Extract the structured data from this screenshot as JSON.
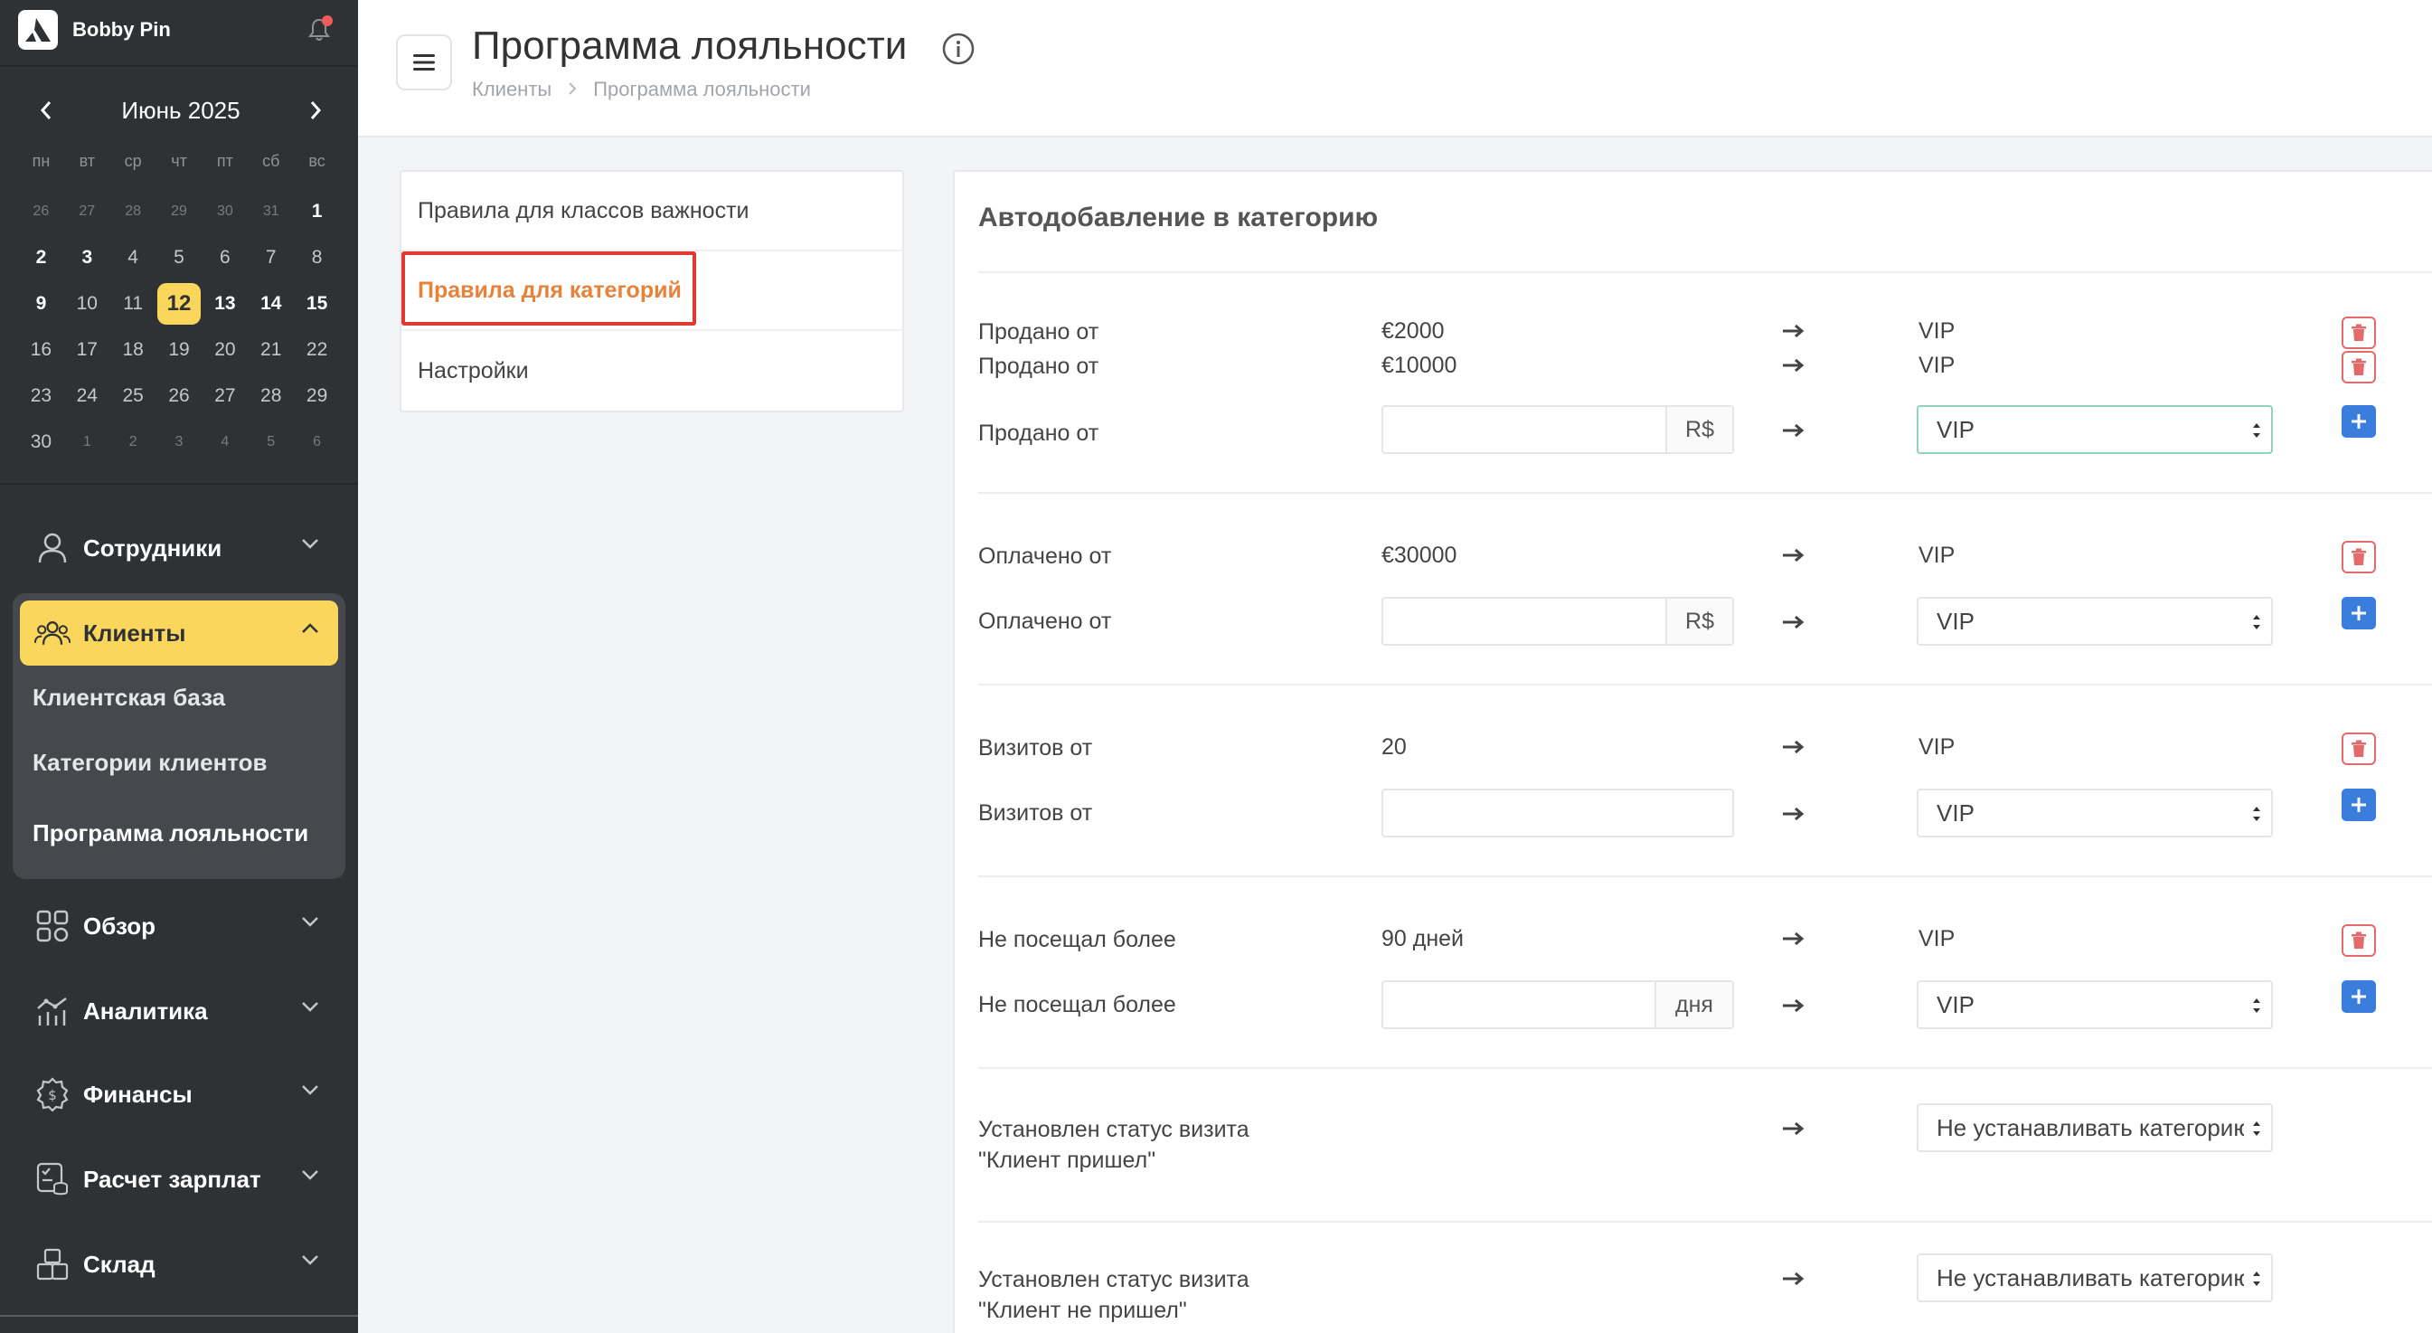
{
  "app": {
    "brand": "Bobby Pin"
  },
  "calendar": {
    "title": "Июнь 2025",
    "weekdays": [
      "пн",
      "вт",
      "ср",
      "чт",
      "пт",
      "сб",
      "вс"
    ],
    "weeks": [
      [
        "26",
        "27",
        "28",
        "29",
        "30",
        "31",
        "1"
      ],
      [
        "2",
        "3",
        "4",
        "5",
        "6",
        "7",
        "8"
      ],
      [
        "9",
        "10",
        "11",
        "12",
        "13",
        "14",
        "15"
      ],
      [
        "16",
        "17",
        "18",
        "19",
        "20",
        "21",
        "22"
      ],
      [
        "23",
        "24",
        "25",
        "26",
        "27",
        "28",
        "29"
      ],
      [
        "30",
        "1",
        "2",
        "3",
        "4",
        "5",
        "6"
      ]
    ],
    "today": "12"
  },
  "sidebar": {
    "employees": "Сотрудники",
    "clients": "Клиенты",
    "clients_sub": [
      "Клиентская база",
      "Категории клиентов",
      "Программа лояльности"
    ],
    "overview": "Обзор",
    "analytics": "Аналитика",
    "finance": "Финансы",
    "salary": "Расчет зарплат",
    "warehouse": "Склад"
  },
  "header": {
    "title": "Программа лояльности",
    "breadcrumb": [
      "Клиенты",
      "Программа лояльности"
    ]
  },
  "tabs": [
    "Правила для классов важности",
    "Правила для категорий",
    "Настройки"
  ],
  "main": {
    "title": "Автодобавление в категорию",
    "sold": {
      "label": "Продано от",
      "rules": [
        {
          "value": "€2000",
          "category": "VIP"
        },
        {
          "value": "€10000",
          "category": "VIP"
        }
      ],
      "input_value": "",
      "addon": "R$",
      "select": "VIP"
    },
    "paid": {
      "label": "Оплачено от",
      "rules": [
        {
          "value": "€30000",
          "category": "VIP"
        }
      ],
      "input_value": "",
      "addon": "R$",
      "select": "VIP"
    },
    "visits": {
      "label": "Визитов от",
      "rules": [
        {
          "value": "20",
          "category": "VIP"
        }
      ],
      "input_value": "",
      "select": "VIP"
    },
    "not_visited": {
      "label": "Не посещал более",
      "rules": [
        {
          "value": "90 дней",
          "category": "VIP"
        }
      ],
      "input_value": "",
      "addon": "дня",
      "select": "VIP"
    },
    "status_came": {
      "line1": "Установлен статус визита",
      "line2": "\"Клиент пришел\"",
      "select": "Не устанавливать категорию"
    },
    "status_not_came": {
      "line1": "Установлен статус визита",
      "line2": "\"Клиент не пришел\"",
      "select": "Не устанавливать категорию"
    }
  },
  "colors": {
    "accent": "#fad75c",
    "sidebar": "#2f3235",
    "active_tab": "#e8823a",
    "add": "#3a7ddc",
    "delete": "#e36a6a"
  }
}
